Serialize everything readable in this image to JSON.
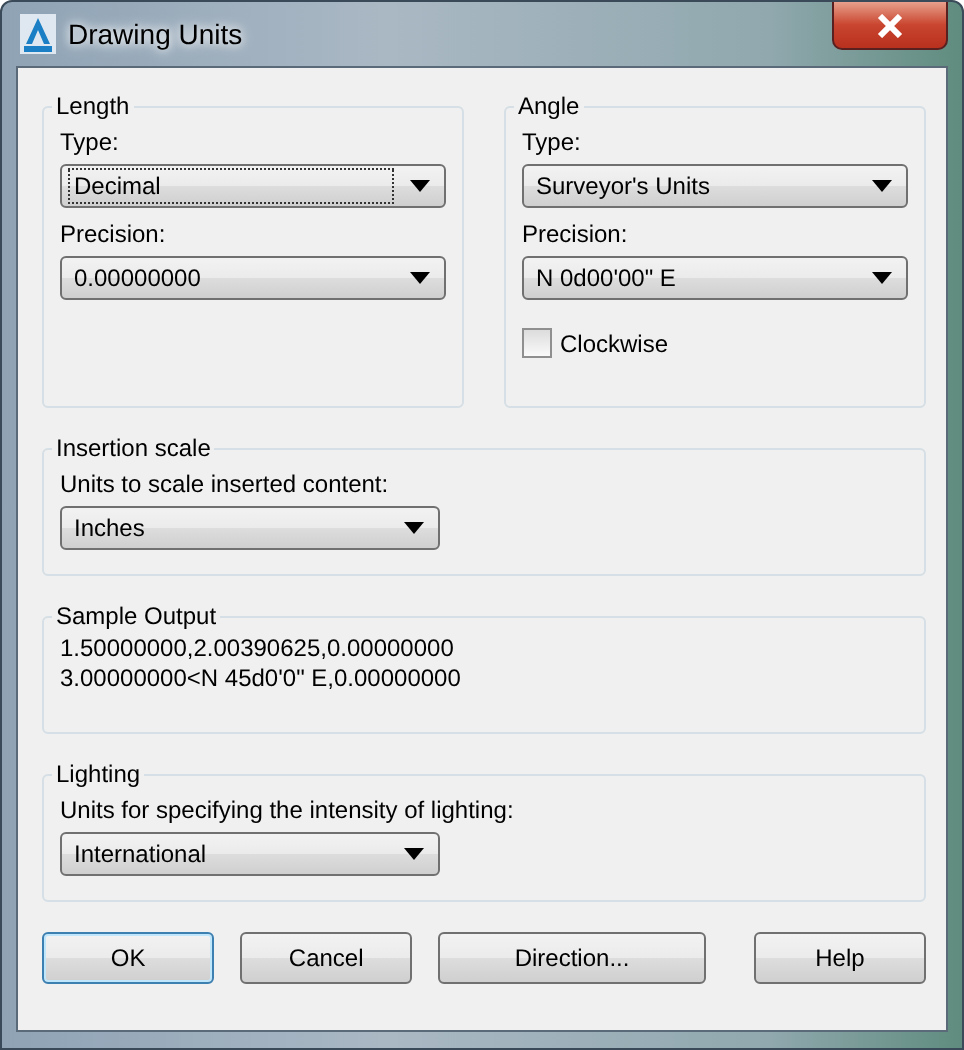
{
  "window": {
    "title": "Drawing Units"
  },
  "length": {
    "title": "Length",
    "type_label": "Type:",
    "type_value": "Decimal",
    "type_focused": true,
    "precision_label": "Precision:",
    "precision_value": "0.00000000"
  },
  "angle": {
    "title": "Angle",
    "type_label": "Type:",
    "type_value": "Surveyor's Units",
    "precision_label": "Precision:",
    "precision_value": "N 0d00'00\" E",
    "clockwise": {
      "label": "Clockwise",
      "checked": false
    }
  },
  "insertion_scale": {
    "title": "Insertion scale",
    "label": "Units to scale inserted content:",
    "value": "Inches"
  },
  "sample_output": {
    "title": "Sample Output",
    "lines": [
      "1.50000000,2.00390625,0.00000000",
      "3.00000000<N 45d0'0\" E,0.00000000"
    ]
  },
  "lighting": {
    "title": "Lighting",
    "label": "Units for specifying the intensity of lighting:",
    "value": "International"
  },
  "buttons": [
    {
      "label": "OK",
      "default": true
    },
    {
      "label": "Cancel",
      "default": false
    },
    {
      "label": "Direction...",
      "default": false
    },
    {
      "label": "Help",
      "default": false
    }
  ]
}
